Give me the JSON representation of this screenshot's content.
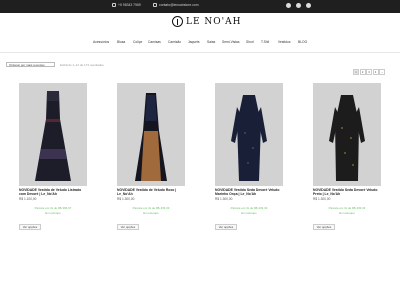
{
  "topbar": {
    "phone": "+5 98343 7969",
    "email": "contato@lenoahstore.com",
    "social": [
      "facebook-icon",
      "instagram-icon",
      "youtube-icon"
    ]
  },
  "brand": {
    "name": "LE NO'AH"
  },
  "nav": [
    "Acessórios",
    "Blusa",
    "Colíçe",
    "Camisas",
    "Camisão",
    "Jaquets",
    "Saias",
    "Semi-Vistas",
    "Shorl",
    "T.Shil",
    "Vestidos",
    "BLOG"
  ],
  "toolbar": {
    "sort_label": "Ordenar por mais recentes",
    "results_text": "Exibindo 1–12 de 174 resultados",
    "pages": [
      "1",
      "2",
      "3",
      "4",
      "→"
    ]
  },
  "products": [
    {
      "name": "NOVIDADE Vestido de Veludo Listrado com Devoré | Le_No'Ah",
      "price": "R$ 1.100,00",
      "promo": "Parcele em 3x de R$ 366,67",
      "stock": "Em estoque",
      "button": "Ver opções"
    },
    {
      "name": "NOVIDADE Vestido de Veludo Roxo | Le_No'Ah",
      "price": "R$ 1.300,00",
      "promo": "Parcele em 3x de R$ 433,33",
      "stock": "Em estoque",
      "button": "Ver opções"
    },
    {
      "name": "NOVIDADE Vestido Seda Devoré Veludo Marinho Onça | Le_No'Ah",
      "price": "R$ 1.300,00",
      "promo": "Parcele em 3x de R$ 433,33",
      "stock": "Em estoque",
      "button": "Ver opções"
    },
    {
      "name": "NOVIDADE Vestido Seda Devoré Veludo Preto | Le_No'Ah",
      "price": "R$ 1.300,00",
      "promo": "Parcele em 3x de R$ 433,33",
      "stock": "Em estoque",
      "button": "Ver opções"
    }
  ]
}
